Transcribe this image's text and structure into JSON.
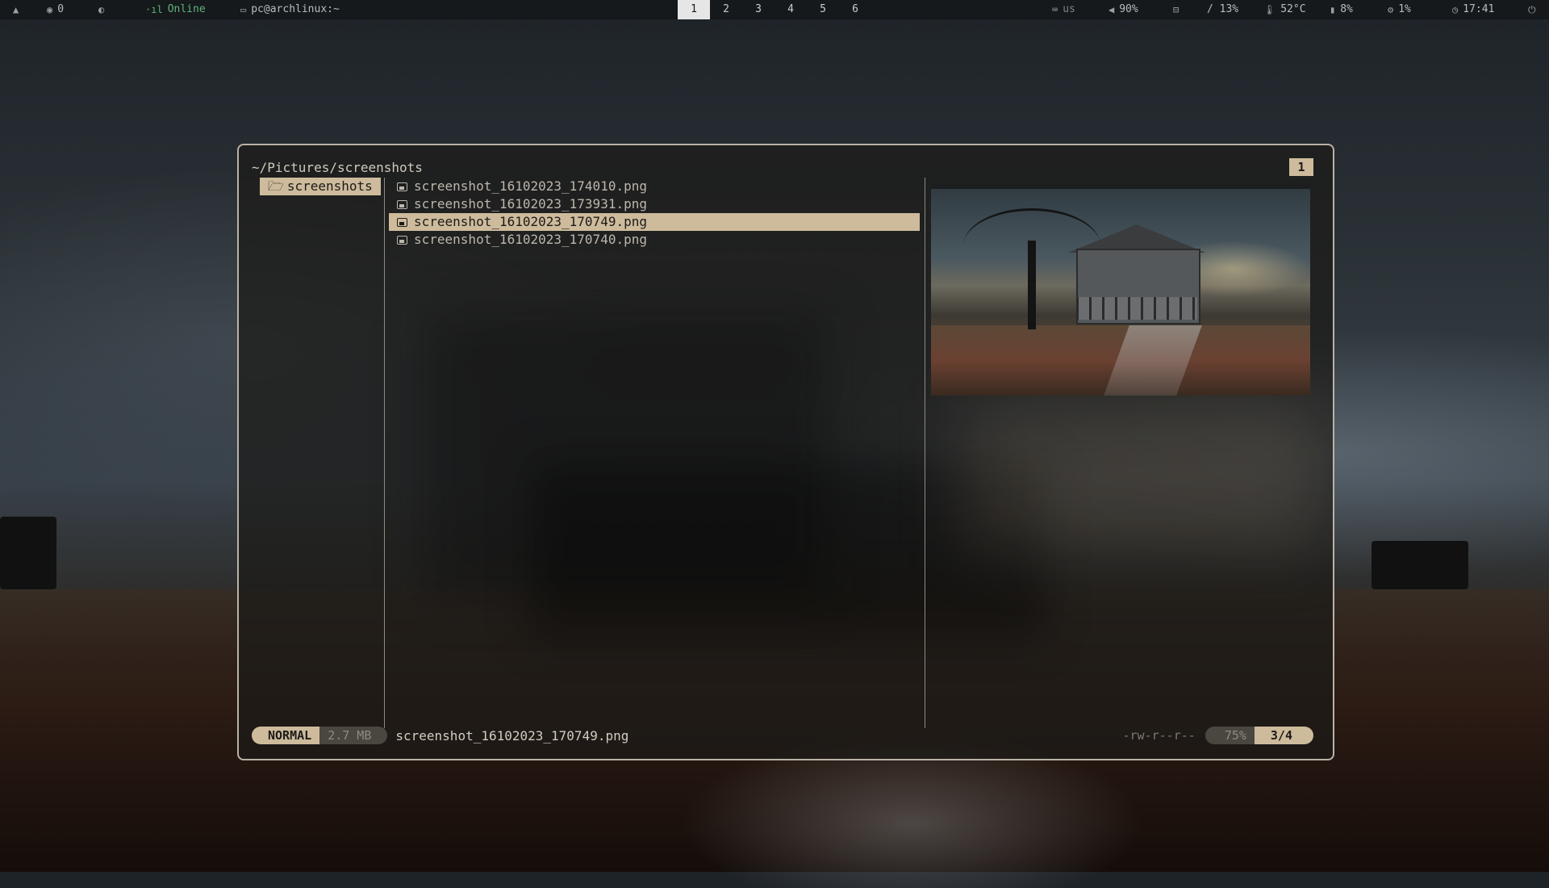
{
  "topbar": {
    "launcher_icon": "arch-logo-icon",
    "github_icon": "github-icon",
    "github_count": "0",
    "power_profile_icon": "power-profile-icon",
    "network_icon": "signal-icon",
    "network_status": "Online",
    "window_icon": "terminal-icon",
    "window_title": "pc@archlinux:~",
    "workspaces": [
      "1",
      "2",
      "3",
      "4",
      "5",
      "6"
    ],
    "active_workspace": "1",
    "keyboard_icon": "keyboard-icon",
    "keyboard_layout": "us",
    "volume_icon": "volume-icon",
    "volume": "90%",
    "disk_icon": "disk-icon",
    "disk": "/ 13%",
    "temp_icon": "thermometer-icon",
    "temperature": "52°C",
    "memory_icon": "memory-icon",
    "memory": "8%",
    "cpu_icon": "cpu-icon",
    "cpu": "1%",
    "clock_icon": "clock-icon",
    "time": "17:41",
    "power_icon": "power-icon"
  },
  "file_manager": {
    "path": "~/Pictures/screenshots",
    "tab_number": "1",
    "parent_dir": {
      "icon": "folder-open-icon",
      "label": "screenshots"
    },
    "files": [
      {
        "name": "screenshot_16102023_174010.png",
        "selected": false
      },
      {
        "name": "screenshot_16102023_173931.png",
        "selected": false
      },
      {
        "name": "screenshot_16102023_170749.png",
        "selected": true
      },
      {
        "name": "screenshot_16102023_170740.png",
        "selected": false
      }
    ],
    "status": {
      "mode": "NORMAL",
      "size": "2.7 MB",
      "current_file": "screenshot_16102023_170749.png",
      "permissions": "-rw-r--r--",
      "percent": "75%",
      "position": "3/4"
    }
  },
  "colors": {
    "accent": "#cdbb9c",
    "online": "#5fb37a",
    "topbar_bg": "#16191c"
  }
}
